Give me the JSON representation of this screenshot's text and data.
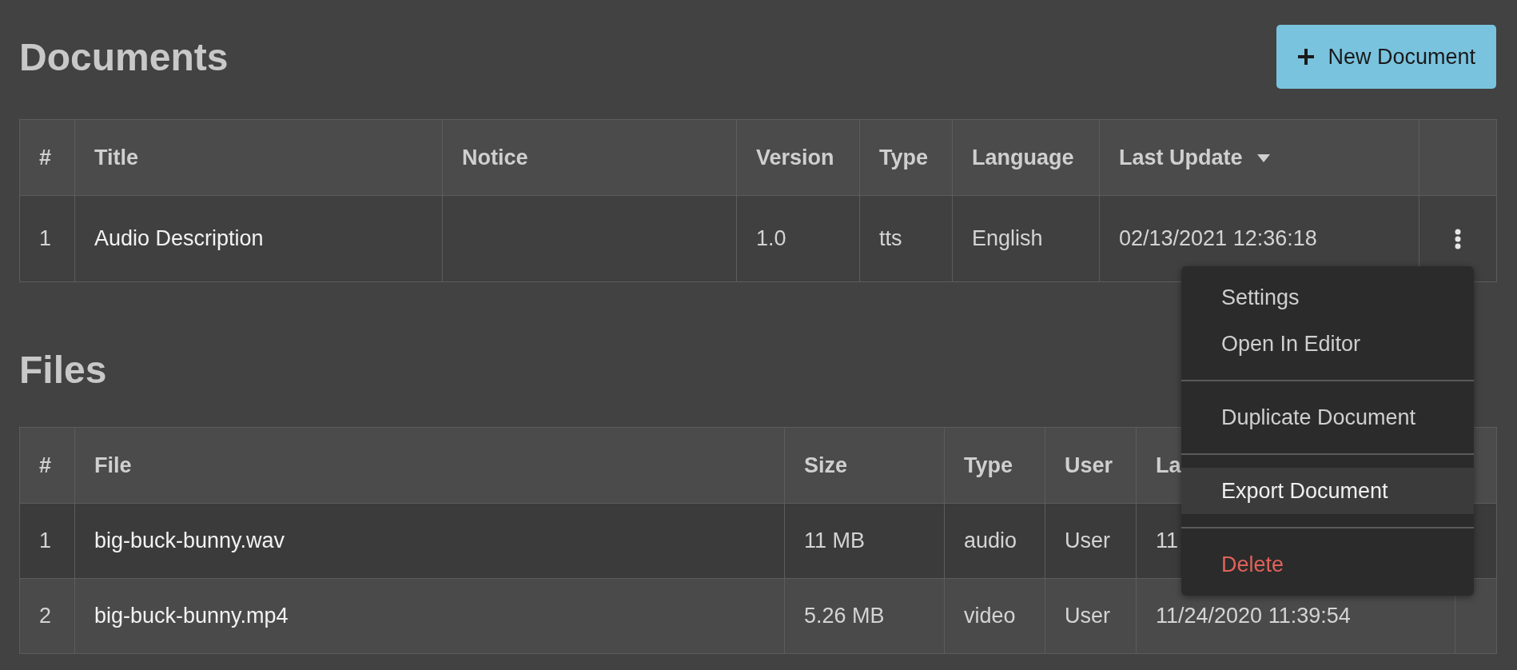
{
  "documents": {
    "title": "Documents",
    "new_button": {
      "label": "New Document"
    },
    "columns": [
      {
        "label": "#",
        "sorted": false
      },
      {
        "label": "Title",
        "sorted": false
      },
      {
        "label": "Notice",
        "sorted": false
      },
      {
        "label": "Version",
        "sorted": false
      },
      {
        "label": "Type",
        "sorted": false
      },
      {
        "label": "Language",
        "sorted": false
      },
      {
        "label": "Last Update",
        "sorted": true
      }
    ],
    "rows": [
      {
        "cells": [
          "1",
          "Audio Description",
          "",
          "1.0",
          "tts",
          "English",
          "02/13/2021 12:36:18"
        ]
      }
    ]
  },
  "context_menu": {
    "groups": [
      [
        {
          "label": "Settings",
          "kind": "normal",
          "selected": false
        },
        {
          "label": "Open In Editor",
          "kind": "normal",
          "selected": false
        }
      ],
      [
        {
          "label": "Duplicate Document",
          "kind": "normal",
          "selected": false
        }
      ],
      [
        {
          "label": "Export Document",
          "kind": "normal",
          "selected": true
        }
      ],
      [
        {
          "label": "Delete",
          "kind": "danger",
          "selected": false
        }
      ]
    ]
  },
  "files": {
    "title": "Files",
    "columns": [
      "#",
      "File",
      "Size",
      "Type",
      "User",
      "La"
    ],
    "rows": [
      {
        "cells": [
          "1",
          "big-buck-bunny.wav",
          "11 MB",
          "audio",
          "User",
          "11"
        ]
      },
      {
        "cells": [
          "2",
          "big-buck-bunny.mp4",
          "5.26 MB",
          "video",
          "User",
          "11/24/2020 11:39:54"
        ]
      }
    ]
  }
}
